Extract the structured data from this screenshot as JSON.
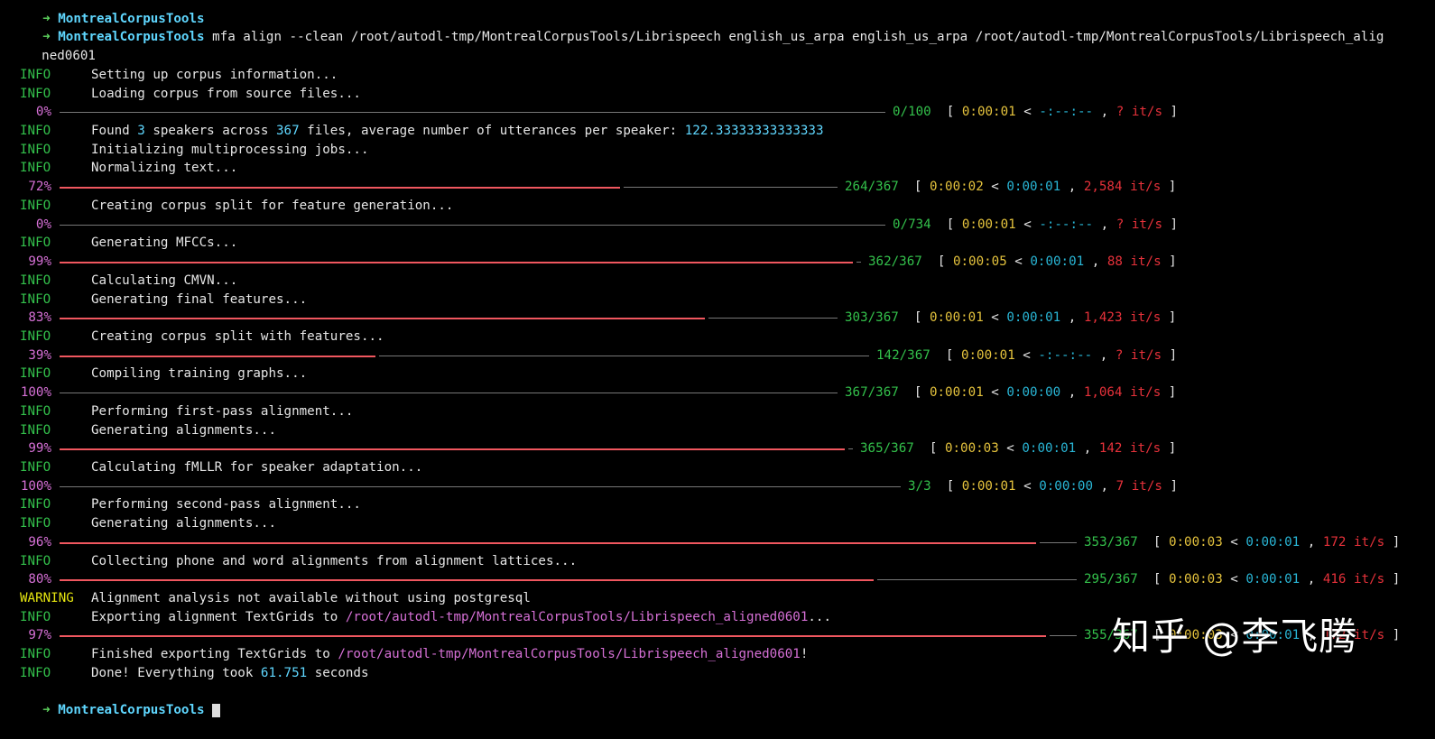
{
  "prompt": {
    "arrow": "➜",
    "cwd": "MontrealCorpusTools",
    "command": "mfa align --clean /root/autodl-tmp/MontrealCorpusTools/Librispeech english_us_arpa english_us_arpa /root/autodl-tmp/MontrealCorpusTools/Librispeech_alig",
    "command_wrap": "ned0601"
  },
  "lines": [
    {
      "type": "log",
      "level": "INFO",
      "text": "Setting up corpus information..."
    },
    {
      "type": "log",
      "level": "INFO",
      "text": "Loading corpus from source files..."
    },
    {
      "type": "progress",
      "pct": "0%",
      "fraction": 0,
      "bar_end": 981,
      "count": "0/100",
      "elapsed": "0:00:01",
      "remaining": "-:--:--",
      "rate": "?",
      "rate_unit": "it/s"
    },
    {
      "type": "found",
      "level": "INFO"
    },
    {
      "type": "log",
      "level": "INFO",
      "text": "Initializing multiprocessing jobs..."
    },
    {
      "type": "log",
      "level": "INFO",
      "text": "Normalizing text..."
    },
    {
      "type": "progress",
      "pct": "72%",
      "fraction": 0.72,
      "bar_end": 928,
      "count": "264/367",
      "elapsed": "0:00:02",
      "remaining": "0:00:01",
      "rate": "2,584",
      "rate_unit": "it/s"
    },
    {
      "type": "log",
      "level": "INFO",
      "text": "Creating corpus split for feature generation..."
    },
    {
      "type": "progress",
      "pct": "0%",
      "fraction": 0,
      "bar_end": 981,
      "count": "0/734",
      "elapsed": "0:00:01",
      "remaining": "-:--:--",
      "rate": "?",
      "rate_unit": "it/s"
    },
    {
      "type": "log",
      "level": "INFO",
      "text": "Generating MFCCs..."
    },
    {
      "type": "progress",
      "pct": "99%",
      "fraction": 0.99,
      "bar_end": 954,
      "count": "362/367",
      "elapsed": "0:00:05",
      "remaining": "0:00:01",
      "rate": "88",
      "rate_unit": "it/s"
    },
    {
      "type": "log",
      "level": "INFO",
      "text": "Calculating CMVN..."
    },
    {
      "type": "log",
      "level": "INFO",
      "text": "Generating final features..."
    },
    {
      "type": "progress",
      "pct": "83%",
      "fraction": 0.83,
      "bar_end": 928,
      "count": "303/367",
      "elapsed": "0:00:01",
      "remaining": "0:00:01",
      "rate": "1,423",
      "rate_unit": "it/s"
    },
    {
      "type": "log",
      "level": "INFO",
      "text": "Creating corpus split with features..."
    },
    {
      "type": "progress",
      "pct": "39%",
      "fraction": 0.39,
      "bar_end": 963,
      "count": "142/367",
      "elapsed": "0:00:01",
      "remaining": "-:--:--",
      "rate": "?",
      "rate_unit": "it/s"
    },
    {
      "type": "log",
      "level": "INFO",
      "text": "Compiling training graphs..."
    },
    {
      "type": "progress",
      "pct": "100%",
      "fraction": 1,
      "gray_full": true,
      "bar_end": 928,
      "count": "367/367",
      "elapsed": "0:00:01",
      "remaining": "0:00:00",
      "rate": "1,064",
      "rate_unit": "it/s"
    },
    {
      "type": "log",
      "level": "INFO",
      "text": "Performing first-pass alignment..."
    },
    {
      "type": "log",
      "level": "INFO",
      "text": "Generating alignments..."
    },
    {
      "type": "progress",
      "pct": "99%",
      "fraction": 0.99,
      "bar_end": 945,
      "count": "365/367",
      "elapsed": "0:00:03",
      "remaining": "0:00:01",
      "rate": "142",
      "rate_unit": "it/s"
    },
    {
      "type": "log",
      "level": "INFO",
      "text": "Calculating fMLLR for speaker adaptation..."
    },
    {
      "type": "progress",
      "pct": "100%",
      "fraction": 1,
      "gray_full": true,
      "bar_end": 998,
      "count": "3/3",
      "elapsed": "0:00:01",
      "remaining": "0:00:00",
      "rate": "7",
      "rate_unit": "it/s"
    },
    {
      "type": "log",
      "level": "INFO",
      "text": "Performing second-pass alignment..."
    },
    {
      "type": "log",
      "level": "INFO",
      "text": "Generating alignments..."
    },
    {
      "type": "progress",
      "pct": "96%",
      "fraction": 0.96,
      "bar_end": 1193,
      "count": "353/367",
      "elapsed": "0:00:03",
      "remaining": "0:00:01",
      "rate": "172",
      "rate_unit": "it/s"
    },
    {
      "type": "log",
      "level": "INFO",
      "text": "Collecting phone and word alignments from alignment lattices..."
    },
    {
      "type": "progress",
      "pct": "80%",
      "fraction": 0.8,
      "bar_end": 1193,
      "count": "295/367",
      "elapsed": "0:00:03",
      "remaining": "0:00:01",
      "rate": "416",
      "rate_unit": "it/s"
    },
    {
      "type": "log",
      "level": "WARNING",
      "text": "Alignment analysis not available without using postgresql"
    },
    {
      "type": "pathlog",
      "level": "INFO",
      "pre": "Exporting alignment TextGrids to ",
      "path": "/root/autodl-tmp/MontrealCorpusTools/Librispeech_aligned0601",
      "post": "..."
    },
    {
      "type": "progress",
      "pct": "97%",
      "fraction": 0.97,
      "bar_end": 1193,
      "count": "355/367",
      "elapsed": "0:00:03",
      "remaining": "0:00:01",
      "rate": "172",
      "rate_unit": "it/s"
    },
    {
      "type": "pathlog",
      "level": "INFO",
      "pre": "Finished exporting TextGrids to ",
      "path": "/root/autodl-tmp/MontrealCorpusTools/Librispeech_aligned0601",
      "post": "!"
    },
    {
      "type": "done",
      "level": "INFO"
    }
  ],
  "found": {
    "pre": "Found ",
    "speakers": "3",
    "mid": " speakers across ",
    "files": "367",
    "post": " files, average number of utterances per speaker: ",
    "avg": "122.33333333333333"
  },
  "done": {
    "pre": "Done! Everything took ",
    "secs": "61.751",
    "post": " seconds"
  },
  "final_prompt": "MontrealCorpusTools",
  "watermark": "知乎 @李飞腾",
  "colors": {
    "background": "#000000",
    "info": "#33c04b",
    "warning": "#e5e510",
    "percent": "#d670d6",
    "bar_done": "#f0575f",
    "rate": "#e6313a",
    "remaining": "#29b6d6",
    "elapsed": "#e5c33d"
  }
}
